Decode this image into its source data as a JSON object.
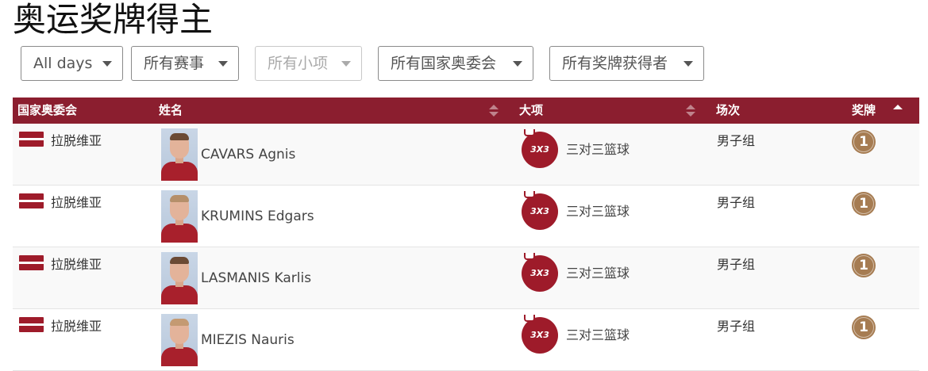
{
  "page": {
    "title": "奥运奖牌得主"
  },
  "filters": {
    "days": "All days",
    "events": "所有赛事",
    "subevents": "所有小项",
    "nocs": "所有国家奥委会",
    "winners": "所有奖牌获得者"
  },
  "table": {
    "headers": {
      "noc": "国家奥委会",
      "name": "姓名",
      "sport": "大项",
      "event": "场次",
      "medal": "奖牌"
    },
    "rows": [
      {
        "country": "拉脱维亚",
        "name": "CAVARS Agnis",
        "sport_icon": "3x3-basketball-icon",
        "sport_icon_text": "3X3",
        "sport": "三对三篮球",
        "event": "男子组",
        "medal": "1"
      },
      {
        "country": "拉脱维亚",
        "name": "KRUMINS Edgars",
        "sport_icon": "3x3-basketball-icon",
        "sport_icon_text": "3X3",
        "sport": "三对三篮球",
        "event": "男子组",
        "medal": "1"
      },
      {
        "country": "拉脱维亚",
        "name": "LASMANIS Karlis",
        "sport_icon": "3x3-basketball-icon",
        "sport_icon_text": "3X3",
        "sport": "三对三篮球",
        "event": "男子组",
        "medal": "1"
      },
      {
        "country": "拉脱维亚",
        "name": "MIEZIS Nauris",
        "sport_icon": "3x3-basketball-icon",
        "sport_icon_text": "3X3",
        "sport": "三对三篮球",
        "event": "男子组",
        "medal": "1"
      }
    ]
  },
  "colors": {
    "header_bg": "#8b1e2f",
    "flag_red": "#9e1b2a",
    "medal_bronze": "#a67c52"
  }
}
